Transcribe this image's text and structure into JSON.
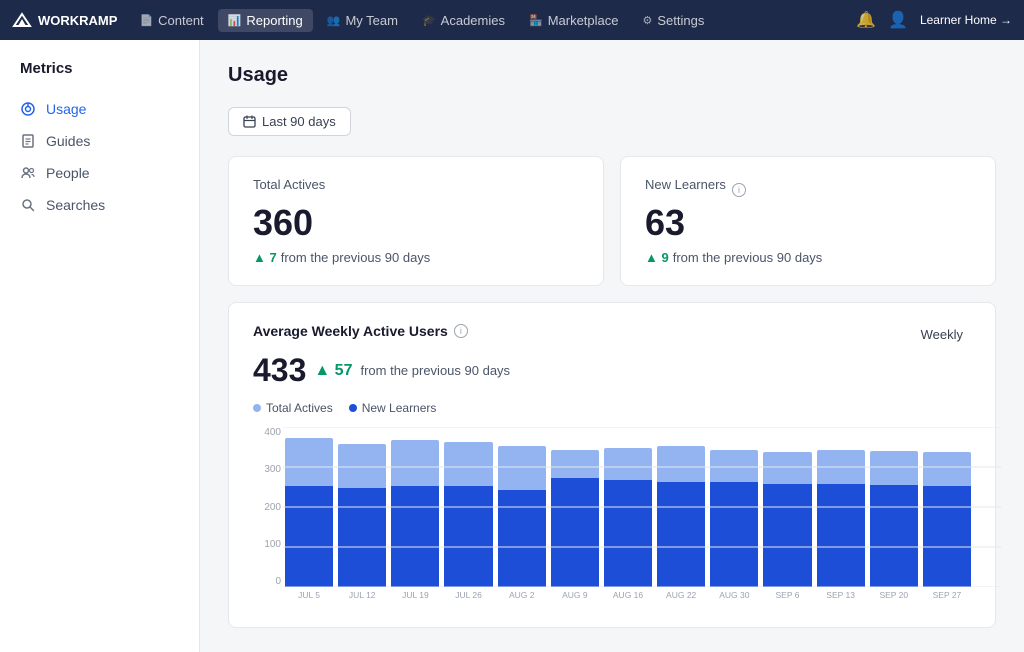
{
  "topnav": {
    "logo": "WORKRAMP",
    "items": [
      {
        "label": "Content",
        "icon": "📄",
        "active": false
      },
      {
        "label": "Reporting",
        "icon": "📊",
        "active": true
      },
      {
        "label": "My Team",
        "icon": "👥",
        "active": false
      },
      {
        "label": "Academies",
        "icon": "🎓",
        "active": false
      },
      {
        "label": "Marketplace",
        "icon": "🏪",
        "active": false
      },
      {
        "label": "Settings",
        "icon": "⚙",
        "active": false
      }
    ],
    "learner_home": "Learner Home →"
  },
  "sidebar": {
    "title": "Metrics",
    "items": [
      {
        "label": "Usage",
        "active": true
      },
      {
        "label": "Guides",
        "active": false
      },
      {
        "label": "People",
        "active": false
      },
      {
        "label": "Searches",
        "active": false
      }
    ]
  },
  "main": {
    "page_title": "Usage",
    "filter_label": "Last 90 days",
    "stats": [
      {
        "label": "Total Actives",
        "value": "360",
        "delta": "7",
        "delta_suffix": "from the previous 90 days",
        "has_info": false
      },
      {
        "label": "New Learners",
        "value": "63",
        "delta": "9",
        "delta_suffix": "from the previous 90 days",
        "has_info": true
      }
    ],
    "chart": {
      "title": "Average Weekly Active Users",
      "weekly_label": "Weekly",
      "value": "433",
      "delta": "57",
      "delta_suffix": "from the previous 90 days",
      "legend": [
        {
          "label": "Total Actives",
          "color": "#93b4f0"
        },
        {
          "label": "New Learners",
          "color": "#1d4ed8"
        }
      ],
      "y_labels": [
        "0",
        "100",
        "200",
        "300",
        "400"
      ],
      "bars": [
        {
          "label": "JUL 5",
          "total": 390,
          "new": 265
        },
        {
          "label": "JUL 12",
          "total": 375,
          "new": 260
        },
        {
          "label": "JUL 19",
          "total": 385,
          "new": 265
        },
        {
          "label": "JUL 26",
          "total": 380,
          "new": 265
        },
        {
          "label": "AUG 2",
          "total": 370,
          "new": 255
        },
        {
          "label": "AUG 9",
          "total": 360,
          "new": 285
        },
        {
          "label": "AUG 16",
          "total": 365,
          "new": 280
        },
        {
          "label": "AUG 22",
          "total": 370,
          "new": 275
        },
        {
          "label": "AUG 30",
          "total": 360,
          "new": 275
        },
        {
          "label": "SEP 6",
          "total": 355,
          "new": 270
        },
        {
          "label": "SEP 13",
          "total": 360,
          "new": 270
        },
        {
          "label": "SEP 20",
          "total": 358,
          "new": 268
        },
        {
          "label": "SEP 27",
          "total": 355,
          "new": 265
        }
      ],
      "max_value": 420
    }
  }
}
